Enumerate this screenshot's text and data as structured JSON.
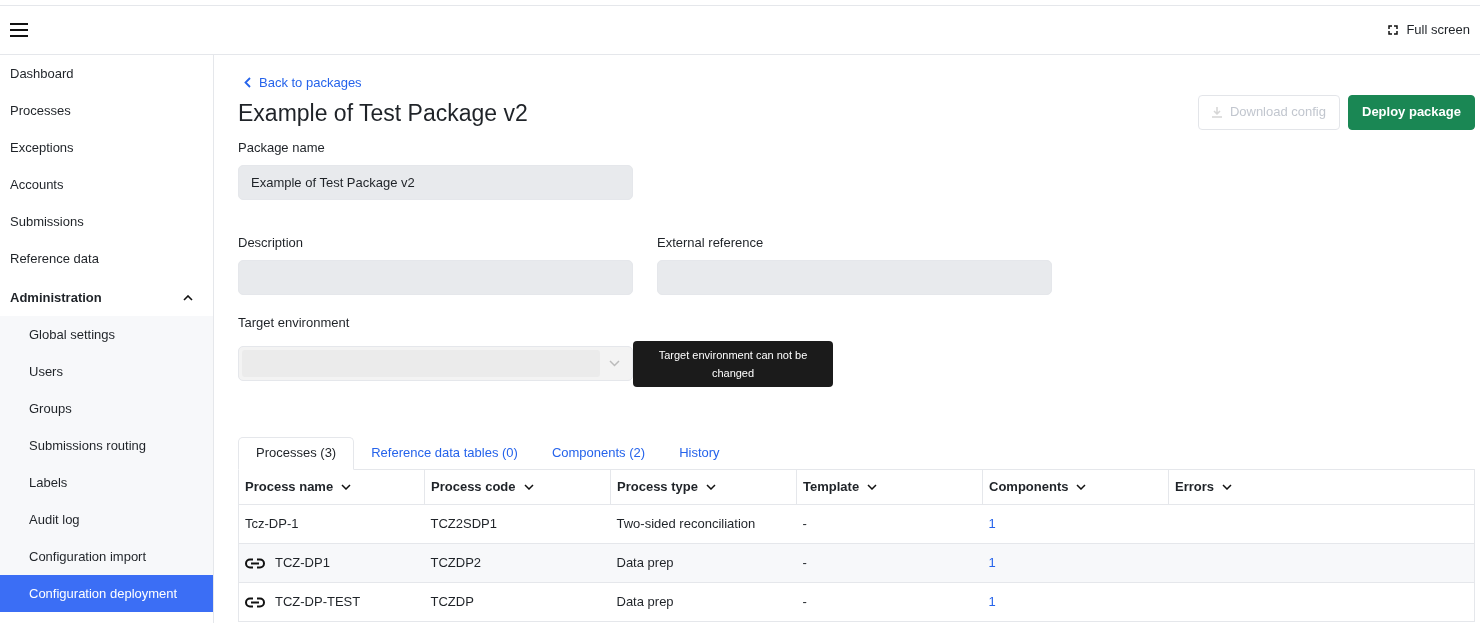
{
  "topbar": {
    "fullscreen": "Full screen"
  },
  "sidebar": {
    "items": [
      {
        "label": "Dashboard",
        "selected": false
      },
      {
        "label": "Processes",
        "selected": false
      },
      {
        "label": "Exceptions",
        "selected": false
      },
      {
        "label": "Accounts",
        "selected": false
      },
      {
        "label": "Submissions",
        "selected": false
      },
      {
        "label": "Reference data",
        "selected": false
      },
      {
        "label": "Administration",
        "selected": false,
        "expanded": true,
        "children": [
          {
            "label": "Global settings",
            "selected": false
          },
          {
            "label": "Users",
            "selected": false
          },
          {
            "label": "Groups",
            "selected": false
          },
          {
            "label": "Submissions routing",
            "selected": false
          },
          {
            "label": "Labels",
            "selected": false
          },
          {
            "label": "Audit log",
            "selected": false
          },
          {
            "label": "Configuration import",
            "selected": false
          },
          {
            "label": "Configuration deployment",
            "selected": true
          }
        ]
      }
    ]
  },
  "back_link": "Back to packages",
  "title": "Example of Test Package v2",
  "buttons": [
    {
      "label": "Download config",
      "kind": "outline",
      "disabled": true
    },
    {
      "label": "Deploy package",
      "kind": "primary",
      "disabled": false
    }
  ],
  "form": {
    "package_name": {
      "label": "Package name",
      "value": "Example of Test Package v2"
    },
    "description": {
      "label": "Description"
    },
    "external_reference": {
      "label": "External reference"
    },
    "target_environment": {
      "label": "Target environment",
      "disabled": true,
      "tooltip": "Target environment can not be changed"
    }
  },
  "tabs": [
    {
      "label": "Processes (3)",
      "selected": true
    },
    {
      "label": "Reference data tables (0)",
      "selected": false
    },
    {
      "label": "Components (2)",
      "selected": false
    },
    {
      "label": "History",
      "selected": false
    }
  ],
  "table": {
    "columns": [
      "Process name",
      "Process code",
      "Process type",
      "Template",
      "Components",
      "Errors"
    ],
    "rows": [
      {
        "linked": false,
        "highlighted": false,
        "cells": [
          "Tcz-DP-1",
          "TCZ2SDP1",
          "Two-sided reconciliation",
          "-",
          "1",
          ""
        ]
      },
      {
        "linked": true,
        "highlighted": true,
        "cells": [
          "TCZ-DP1",
          "TCZDP2",
          "Data prep",
          "-",
          "1",
          ""
        ]
      },
      {
        "linked": true,
        "highlighted": false,
        "cells": [
          "TCZ-DP-TEST",
          "TCZDP",
          "Data prep",
          "-",
          "1",
          ""
        ]
      }
    ]
  }
}
